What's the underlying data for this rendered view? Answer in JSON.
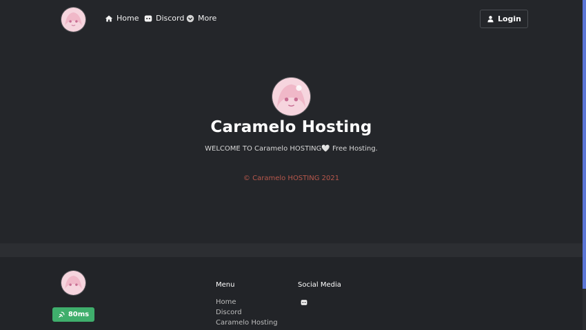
{
  "nav": {
    "items": [
      {
        "label": "Home",
        "icon": "home-icon"
      },
      {
        "label": "Discord",
        "icon": "discord-icon"
      },
      {
        "label": "More",
        "icon": "chevron-down-icon"
      }
    ],
    "login_label": "Login"
  },
  "hero": {
    "title": "Caramelo Hosting",
    "subtitle": "WELCOME TO Caramelo HOSTING🤍 Free Hosting.",
    "copyright": "© Caramelo HOSTING 2021"
  },
  "footer": {
    "ping": "80ms",
    "menu_heading": "Menu",
    "menu_links": [
      "Home",
      "Discord",
      "Caramelo Hosting"
    ],
    "social_heading": "Social Media",
    "social_icons": [
      "discord-icon"
    ]
  },
  "colors": {
    "background": "#24262a",
    "footer_band": "#2c2e32",
    "accent_copyright": "#b8584c",
    "ping_badge": "#3fae6c",
    "scrollbar": "#5b76d6"
  }
}
